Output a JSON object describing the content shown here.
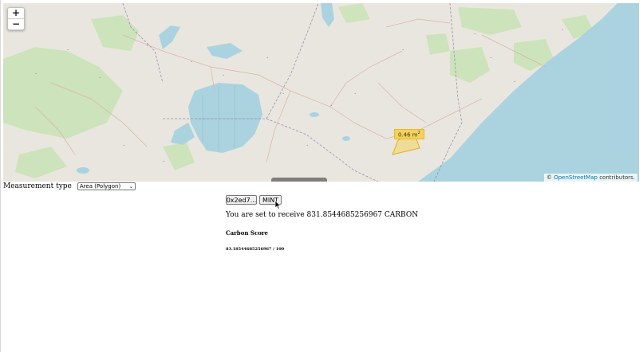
{
  "map": {
    "zoom_in_label": "+",
    "zoom_out_label": "−",
    "area_measurement": "0.46 m",
    "area_unit_exponent": "2",
    "attribution_symbol": "©",
    "attribution_link": "OpenStreetMap",
    "attribution_suffix": " contributors.",
    "colors": {
      "land": "#e9e6df",
      "water": "#aad3df",
      "forest": "#cbe3b8",
      "boundary": "#9b8ab0",
      "measure_polygon": "#f4d35a"
    }
  },
  "measurement": {
    "label": "Measurement type",
    "selected": "Area (Polygon)"
  },
  "actions": {
    "wallet_label": "0x2ed7...",
    "mint_label": "MINT"
  },
  "info": {
    "receive_text": "You are set to receive 831.8544685256967 CARBON",
    "score_title": "Carbon Score",
    "score_value": "83.18544685256967 / 100"
  }
}
